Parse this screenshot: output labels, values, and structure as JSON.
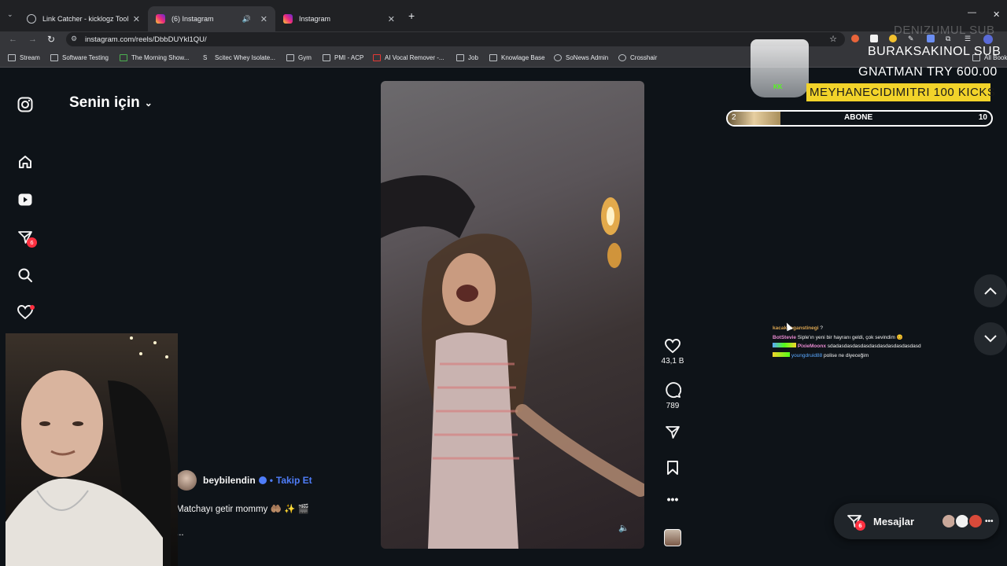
{
  "browser": {
    "tabs": [
      {
        "title": "Link Catcher - kicklogz Tools",
        "active": false
      },
      {
        "title": "(6) Instagram",
        "active": true
      },
      {
        "title": "Instagram",
        "active": false
      }
    ],
    "url": "instagram.com/reels/DbbDUYkl1QU/",
    "bookmarks": [
      "Stream",
      "Software Testing",
      "The Morning Show...",
      "Scitec Whey Isolate...",
      "Gym",
      "PMI - ACP",
      "AI Vocal Remover -...",
      "Job",
      "Knowlage Base",
      "SoNews Admin",
      "Crosshair",
      "All Book"
    ]
  },
  "sidebar": {
    "feed_title": "Senin için",
    "notifications_badge": "6"
  },
  "reel": {
    "author": "beybilendin",
    "follow_label": "Takip Et",
    "separator": "•",
    "caption": "Matchayı getir mommy 🤲🏽 ✨ 🎬",
    "caption_more": "...",
    "likes": "43,1 B",
    "comments": "789"
  },
  "overlay": {
    "sub1": "DENIZUMUL SUB",
    "sub2": "BURAKSAKINOL SUB",
    "donation": "GNATMAN TRY 600.00",
    "kicks": "MEYHANECIDIMITRI 100 KICKS",
    "cup_logo": "KK",
    "goal": {
      "current": "2",
      "label": "ABONE",
      "target": "10",
      "progress": 0.2
    }
  },
  "chat": [
    {
      "user": "kacakboganstinegi",
      "msg": "?",
      "color": "#d9a451"
    },
    {
      "user": "BotStevie",
      "msg": "Siple'ın yeni bir hayranı geldi, çok sevindim 😊",
      "color": "#e88ad0"
    },
    {
      "user": "PixieMoonx",
      "msg": "sdadasdasdasdasdasdasdasdasdasdasd",
      "color": "#e88ad0"
    },
    {
      "user": "youngdruid88",
      "msg": "polise ne diyeceğim",
      "color": "#5aa8ff"
    }
  ],
  "messages": {
    "label": "Mesajlar",
    "badge": "6"
  },
  "colors": {
    "accent_blue": "#4f7df9",
    "badge_red": "#ff3040",
    "kicks_bg": "#f2d32a"
  }
}
